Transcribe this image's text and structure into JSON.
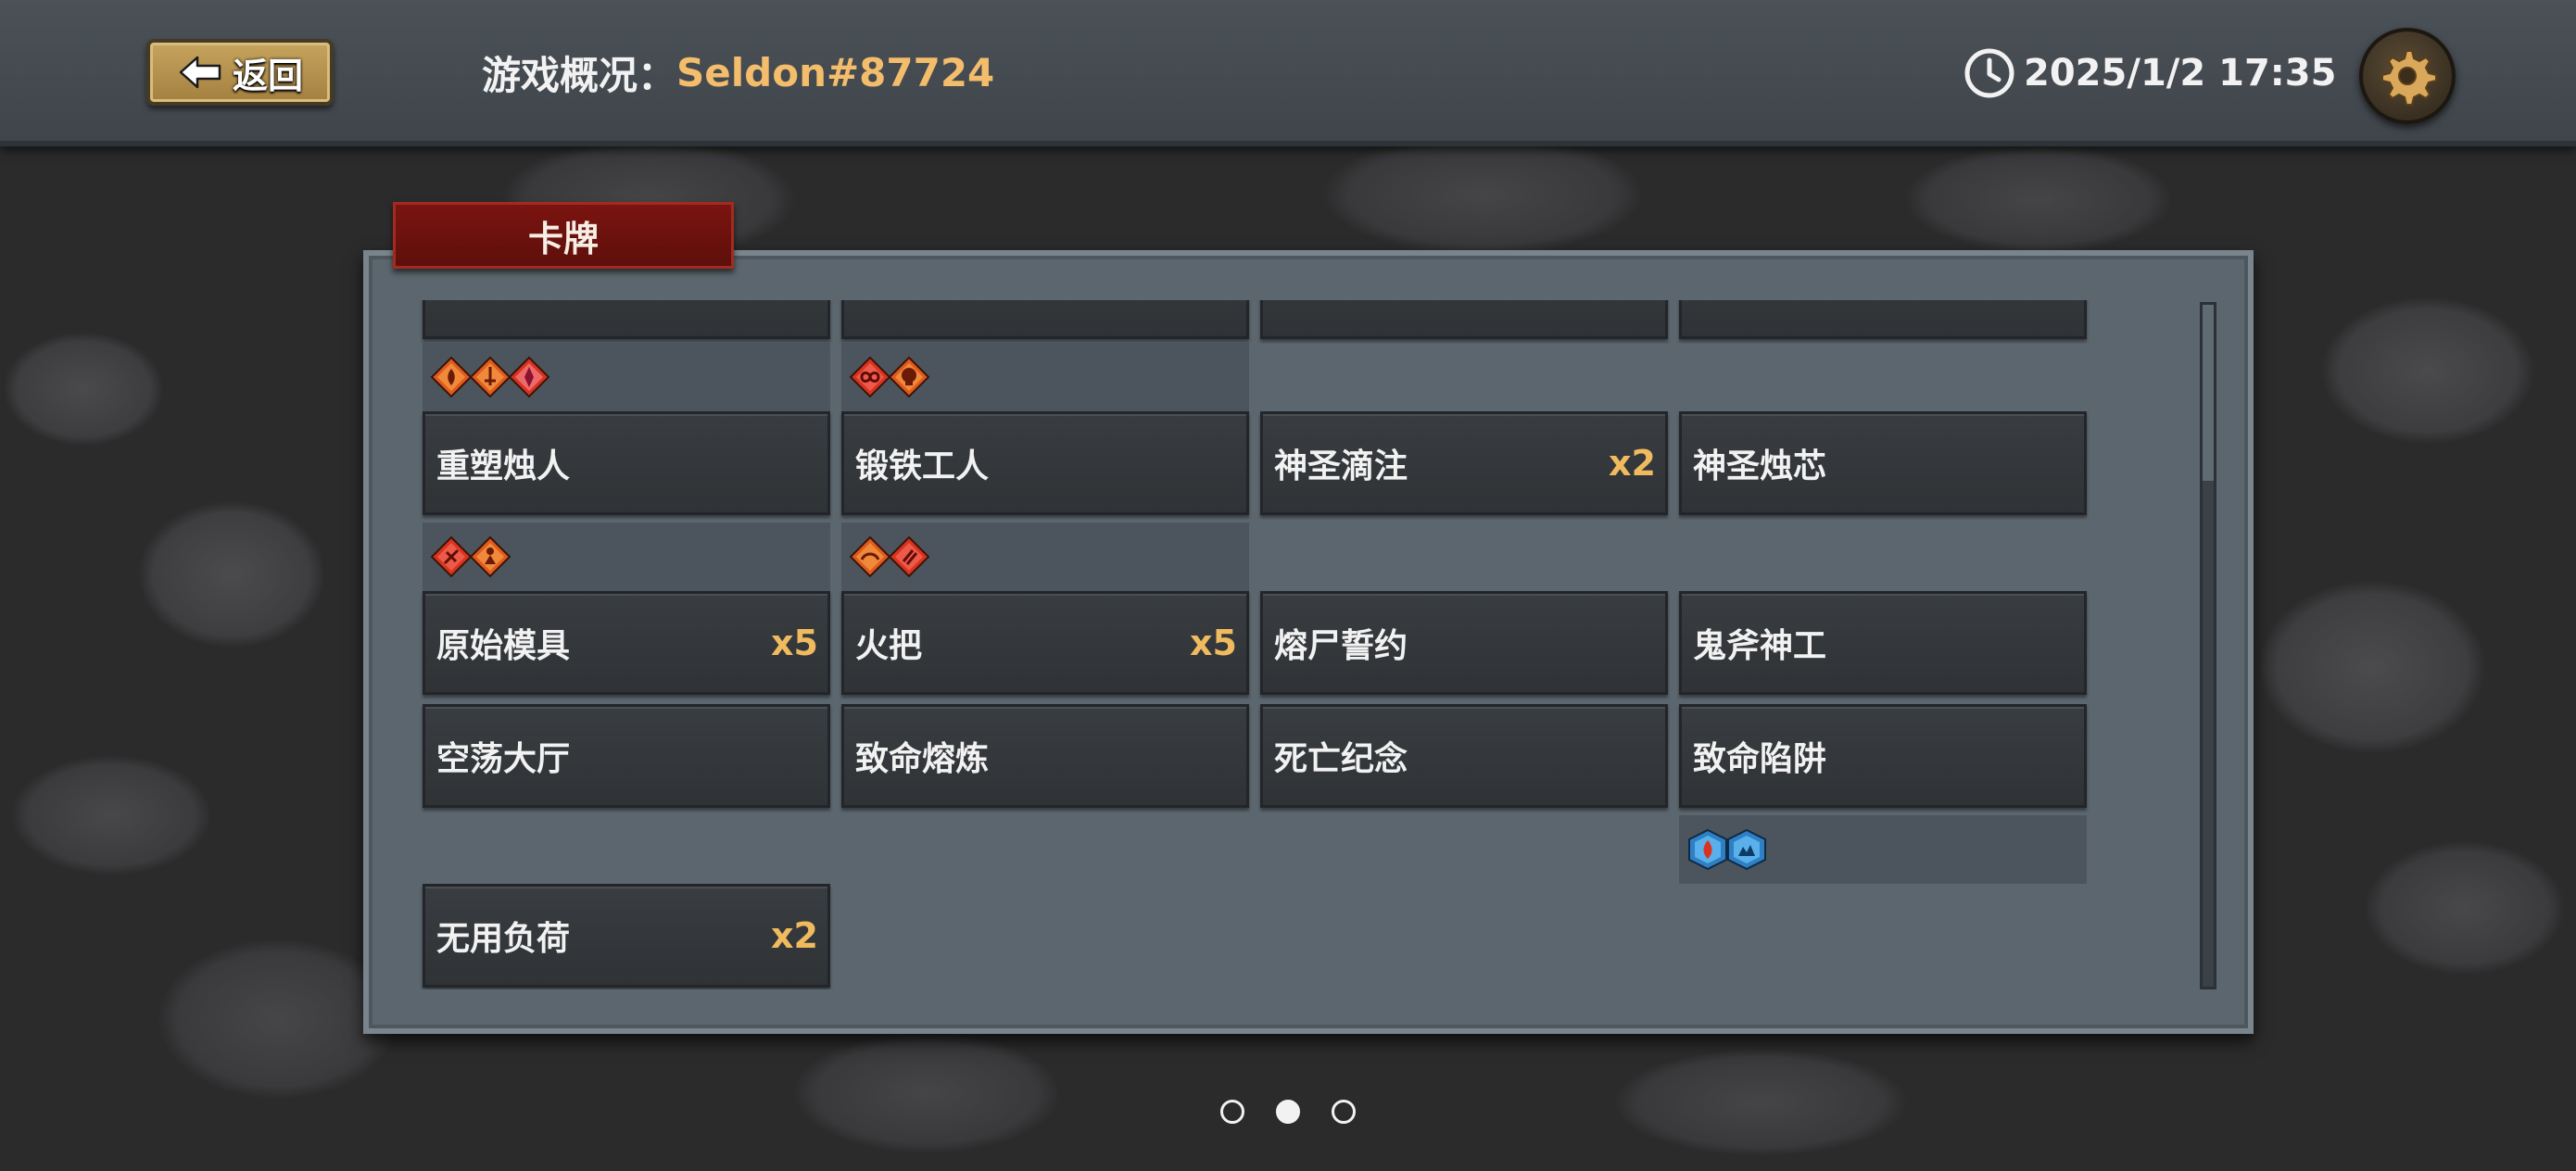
{
  "header": {
    "back_label": "返回",
    "title_label": "游戏概况：",
    "player_name": "Seldon#87724",
    "datetime": "2025/1/2 17:35"
  },
  "panel": {
    "tab_label": "卡牌"
  },
  "cards": [
    {
      "name": "重塑烛人",
      "count": ""
    },
    {
      "name": "锻铁工人",
      "count": ""
    },
    {
      "name": "神圣滴注",
      "count": "x2"
    },
    {
      "name": "神圣烛芯",
      "count": ""
    },
    {
      "name": "原始模具",
      "count": "x5"
    },
    {
      "name": "火把",
      "count": "x5"
    },
    {
      "name": "熔尸誓约",
      "count": ""
    },
    {
      "name": "鬼斧神工",
      "count": ""
    },
    {
      "name": "空荡大厅",
      "count": ""
    },
    {
      "name": "致命熔炼",
      "count": ""
    },
    {
      "name": "死亡纪念",
      "count": ""
    },
    {
      "name": "致命陷阱",
      "count": ""
    },
    {
      "name": "无用负荷",
      "count": "x2"
    }
  ],
  "tag_icons": {
    "row0_col0": [
      "fire-gem-icon",
      "sword-gem-icon",
      "crystal-gem-icon"
    ],
    "row0_col1": [
      "infinity-gem-icon",
      "skull-gem-icon"
    ],
    "row1_col0": [
      "sword-gem-icon",
      "figure-gem-icon"
    ],
    "row1_col1": [
      "chain-gem-icon",
      "bars-gem-icon"
    ],
    "row3_col3": [
      "flame-ice-gem-icon",
      "splash-ice-gem-icon"
    ]
  },
  "pager": {
    "count": 3,
    "active_index": 1
  },
  "colors": {
    "accent_gold": "#f3bd6b",
    "count_gold": "#f0ba5e",
    "tab_red": "#7b1410",
    "gem_red": "#d9331f",
    "gem_blue": "#2f7fc4"
  }
}
